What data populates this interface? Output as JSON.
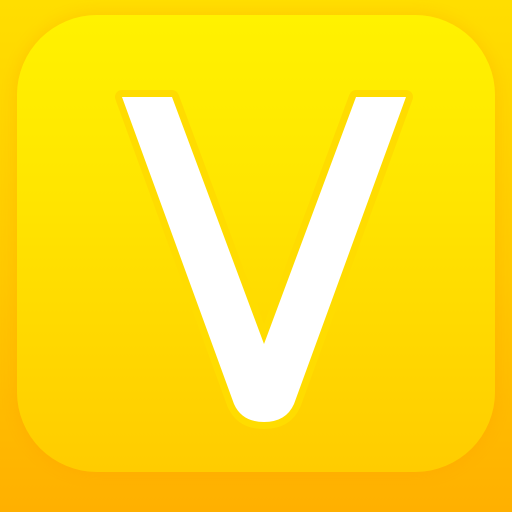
{
  "app_icon": {
    "letter": "V",
    "colors": {
      "background_top": "#ffde00",
      "background_bottom": "#ffb000",
      "tile_top": "#fff200",
      "tile_bottom": "#ffcc00",
      "letter_fill": "#ffffff",
      "letter_outline": "#ffdc00"
    }
  }
}
